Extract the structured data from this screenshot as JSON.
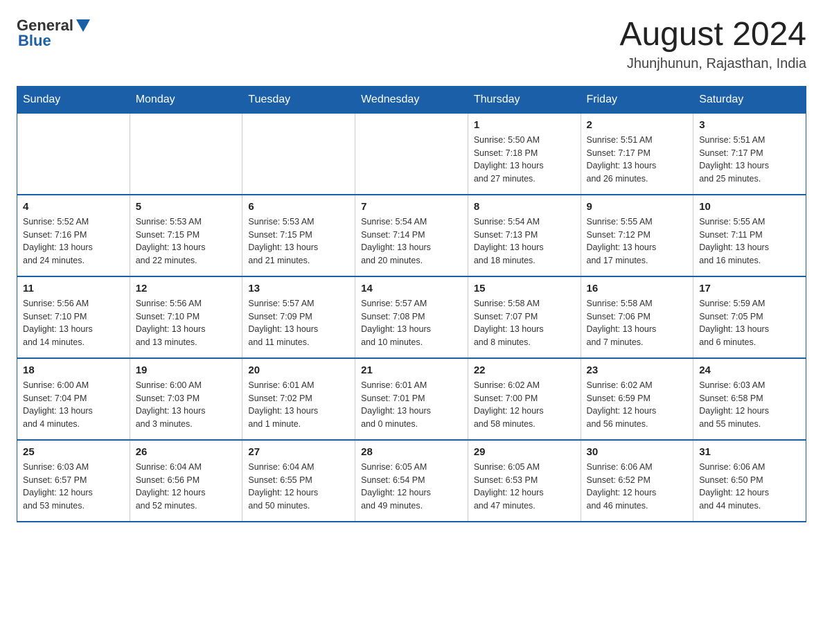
{
  "logo": {
    "text_general": "General",
    "text_blue": "Blue"
  },
  "header": {
    "title": "August 2024",
    "subtitle": "Jhunjhunun, Rajasthan, India"
  },
  "days_of_week": [
    "Sunday",
    "Monday",
    "Tuesday",
    "Wednesday",
    "Thursday",
    "Friday",
    "Saturday"
  ],
  "weeks": [
    {
      "cells": [
        {
          "day": "",
          "info": ""
        },
        {
          "day": "",
          "info": ""
        },
        {
          "day": "",
          "info": ""
        },
        {
          "day": "",
          "info": ""
        },
        {
          "day": "1",
          "info": "Sunrise: 5:50 AM\nSunset: 7:18 PM\nDaylight: 13 hours\nand 27 minutes."
        },
        {
          "day": "2",
          "info": "Sunrise: 5:51 AM\nSunset: 7:17 PM\nDaylight: 13 hours\nand 26 minutes."
        },
        {
          "day": "3",
          "info": "Sunrise: 5:51 AM\nSunset: 7:17 PM\nDaylight: 13 hours\nand 25 minutes."
        }
      ]
    },
    {
      "cells": [
        {
          "day": "4",
          "info": "Sunrise: 5:52 AM\nSunset: 7:16 PM\nDaylight: 13 hours\nand 24 minutes."
        },
        {
          "day": "5",
          "info": "Sunrise: 5:53 AM\nSunset: 7:15 PM\nDaylight: 13 hours\nand 22 minutes."
        },
        {
          "day": "6",
          "info": "Sunrise: 5:53 AM\nSunset: 7:15 PM\nDaylight: 13 hours\nand 21 minutes."
        },
        {
          "day": "7",
          "info": "Sunrise: 5:54 AM\nSunset: 7:14 PM\nDaylight: 13 hours\nand 20 minutes."
        },
        {
          "day": "8",
          "info": "Sunrise: 5:54 AM\nSunset: 7:13 PM\nDaylight: 13 hours\nand 18 minutes."
        },
        {
          "day": "9",
          "info": "Sunrise: 5:55 AM\nSunset: 7:12 PM\nDaylight: 13 hours\nand 17 minutes."
        },
        {
          "day": "10",
          "info": "Sunrise: 5:55 AM\nSunset: 7:11 PM\nDaylight: 13 hours\nand 16 minutes."
        }
      ]
    },
    {
      "cells": [
        {
          "day": "11",
          "info": "Sunrise: 5:56 AM\nSunset: 7:10 PM\nDaylight: 13 hours\nand 14 minutes."
        },
        {
          "day": "12",
          "info": "Sunrise: 5:56 AM\nSunset: 7:10 PM\nDaylight: 13 hours\nand 13 minutes."
        },
        {
          "day": "13",
          "info": "Sunrise: 5:57 AM\nSunset: 7:09 PM\nDaylight: 13 hours\nand 11 minutes."
        },
        {
          "day": "14",
          "info": "Sunrise: 5:57 AM\nSunset: 7:08 PM\nDaylight: 13 hours\nand 10 minutes."
        },
        {
          "day": "15",
          "info": "Sunrise: 5:58 AM\nSunset: 7:07 PM\nDaylight: 13 hours\nand 8 minutes."
        },
        {
          "day": "16",
          "info": "Sunrise: 5:58 AM\nSunset: 7:06 PM\nDaylight: 13 hours\nand 7 minutes."
        },
        {
          "day": "17",
          "info": "Sunrise: 5:59 AM\nSunset: 7:05 PM\nDaylight: 13 hours\nand 6 minutes."
        }
      ]
    },
    {
      "cells": [
        {
          "day": "18",
          "info": "Sunrise: 6:00 AM\nSunset: 7:04 PM\nDaylight: 13 hours\nand 4 minutes."
        },
        {
          "day": "19",
          "info": "Sunrise: 6:00 AM\nSunset: 7:03 PM\nDaylight: 13 hours\nand 3 minutes."
        },
        {
          "day": "20",
          "info": "Sunrise: 6:01 AM\nSunset: 7:02 PM\nDaylight: 13 hours\nand 1 minute."
        },
        {
          "day": "21",
          "info": "Sunrise: 6:01 AM\nSunset: 7:01 PM\nDaylight: 13 hours\nand 0 minutes."
        },
        {
          "day": "22",
          "info": "Sunrise: 6:02 AM\nSunset: 7:00 PM\nDaylight: 12 hours\nand 58 minutes."
        },
        {
          "day": "23",
          "info": "Sunrise: 6:02 AM\nSunset: 6:59 PM\nDaylight: 12 hours\nand 56 minutes."
        },
        {
          "day": "24",
          "info": "Sunrise: 6:03 AM\nSunset: 6:58 PM\nDaylight: 12 hours\nand 55 minutes."
        }
      ]
    },
    {
      "cells": [
        {
          "day": "25",
          "info": "Sunrise: 6:03 AM\nSunset: 6:57 PM\nDaylight: 12 hours\nand 53 minutes."
        },
        {
          "day": "26",
          "info": "Sunrise: 6:04 AM\nSunset: 6:56 PM\nDaylight: 12 hours\nand 52 minutes."
        },
        {
          "day": "27",
          "info": "Sunrise: 6:04 AM\nSunset: 6:55 PM\nDaylight: 12 hours\nand 50 minutes."
        },
        {
          "day": "28",
          "info": "Sunrise: 6:05 AM\nSunset: 6:54 PM\nDaylight: 12 hours\nand 49 minutes."
        },
        {
          "day": "29",
          "info": "Sunrise: 6:05 AM\nSunset: 6:53 PM\nDaylight: 12 hours\nand 47 minutes."
        },
        {
          "day": "30",
          "info": "Sunrise: 6:06 AM\nSunset: 6:52 PM\nDaylight: 12 hours\nand 46 minutes."
        },
        {
          "day": "31",
          "info": "Sunrise: 6:06 AM\nSunset: 6:50 PM\nDaylight: 12 hours\nand 44 minutes."
        }
      ]
    }
  ]
}
